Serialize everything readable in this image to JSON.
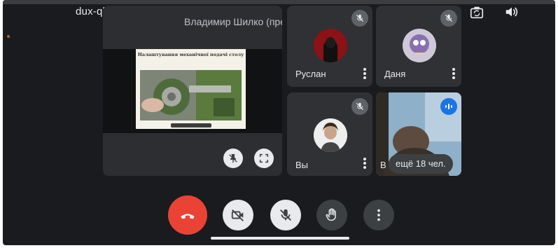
{
  "meeting": {
    "code": "dux-qbut-dzp",
    "code_caret": "▸"
  },
  "presentation": {
    "title": "Владимир Шилко (презента...",
    "slide_title": "Налаштування механічної подачі столу"
  },
  "participants": [
    {
      "name": "Руслан",
      "muted": true
    },
    {
      "name": "Даня",
      "muted": true
    },
    {
      "name": "Вы",
      "muted": true
    },
    {
      "name": "В",
      "speaking": true
    }
  ],
  "overflow": {
    "label": "ещё 18 чел."
  },
  "controls": {
    "end_call_color": "#ea4335",
    "button_color": "#3c4043",
    "muted_button_color": "#e8eaed"
  }
}
